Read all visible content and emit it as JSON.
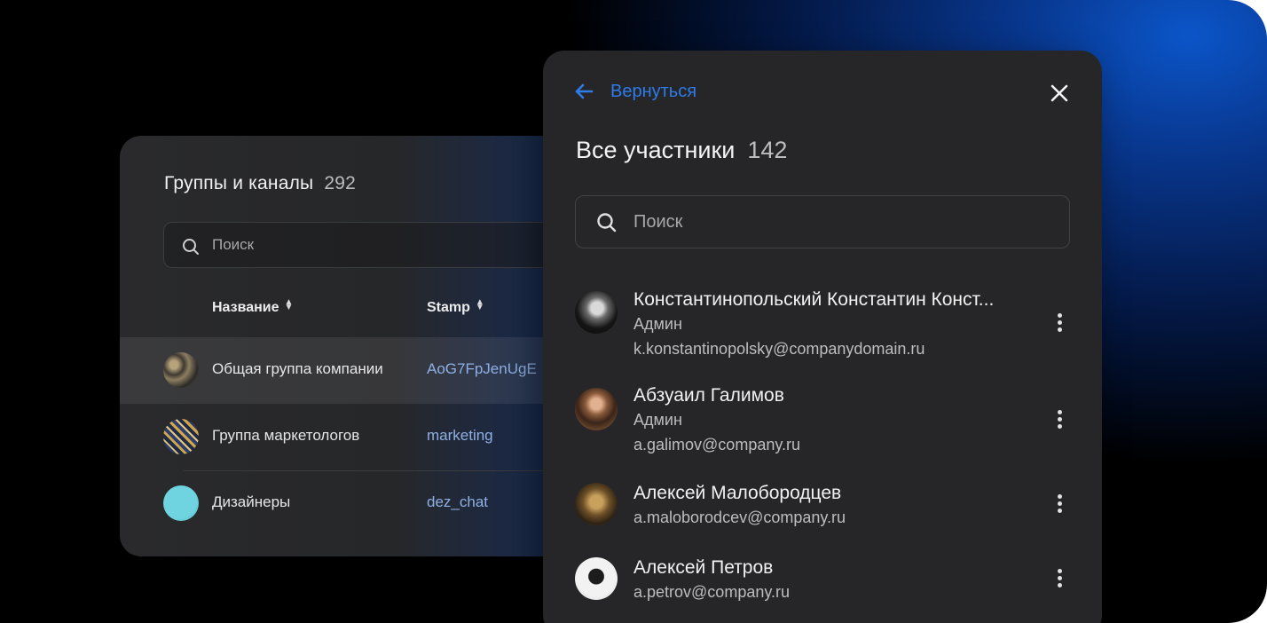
{
  "groups_panel": {
    "title": "Группы и каналы",
    "count": "292",
    "search_placeholder": "Поиск",
    "columns": {
      "name": "Название",
      "stamp": "Stamp"
    },
    "rows": [
      {
        "name": "Общая группа компании",
        "stamp": "AoG7FpJenUgE"
      },
      {
        "name": "Группа маркетологов",
        "stamp": "marketing"
      },
      {
        "name": "Дизайнеры",
        "stamp": "dez_chat"
      }
    ]
  },
  "members_panel": {
    "back_label": "Вернуться",
    "title": "Все участники",
    "count": "142",
    "search_placeholder": "Поиск",
    "members": [
      {
        "name": "Константинопольский Константин Конст...",
        "role": "Админ",
        "email": "k.konstantinopolsky@companydomain.ru"
      },
      {
        "name": "Абзуаил Галимов",
        "role": "Админ",
        "email": "a.galimov@company.ru"
      },
      {
        "name": "Алексей Малобородцев",
        "role": "",
        "email": "a.maloborodcev@company.ru"
      },
      {
        "name": "Алексей Петров",
        "role": "",
        "email": "a.petrov@company.ru"
      }
    ]
  },
  "colors": {
    "accent": "#2e7bea",
    "panel": "#262628",
    "gradient_blue": "#0b55c9"
  }
}
